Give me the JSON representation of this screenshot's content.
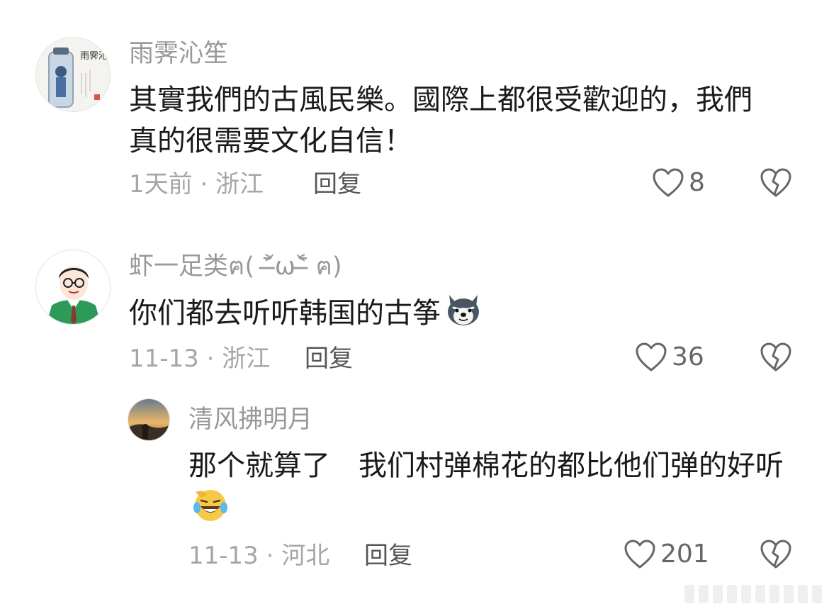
{
  "comments": [
    {
      "username": "雨霁沁笙",
      "content": "其實我們的古風民樂。國際上都很受歡迎的，我們真的很需要文化自信！",
      "meta": "1天前 · 浙江",
      "reply_label": "回复",
      "likes": "8",
      "avatar_text": "雨霁沁笙"
    },
    {
      "username": "虾一足类ฅ( ˃̶᷄ω˂̶᷅ ฅ)",
      "content": "你们都去听听韩国的古筝",
      "meta": "11-13 · 浙江",
      "reply_label": "回复",
      "likes": "36"
    },
    {
      "username": "清风拂明月",
      "content": "那个就算了　我们村弹棉花的都比他们弹的好听",
      "meta": "11-13 · 河北",
      "reply_label": "回复",
      "likes": "201"
    }
  ],
  "icons": {
    "like": "heart-outline-icon",
    "dislike": "broken-heart-icon"
  },
  "colors": {
    "username": "#999999",
    "content": "#1a1a1a",
    "meta": "#a6a6a6",
    "icon": "#666666"
  }
}
